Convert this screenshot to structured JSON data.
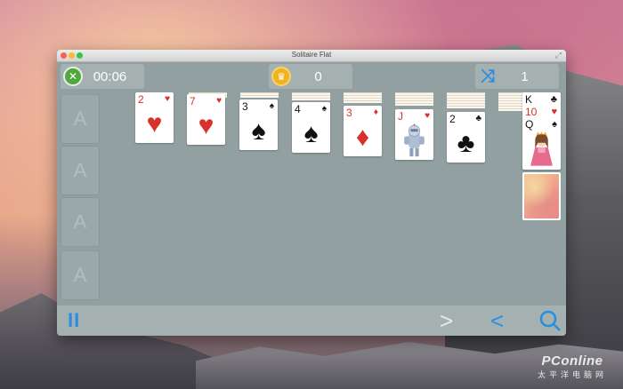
{
  "window": {
    "title": "Solitaire Flat"
  },
  "topbar": {
    "timer": "00:06",
    "score": "0",
    "moves": "1"
  },
  "foundations": [
    {
      "label": "A"
    },
    {
      "label": "A"
    },
    {
      "label": "A"
    },
    {
      "label": "A"
    }
  ],
  "tableau": [
    {
      "rank": "2",
      "suit": "♥",
      "color": "red"
    },
    {
      "rank": "7",
      "suit": "♥",
      "color": "red"
    },
    {
      "rank": "3",
      "suit": "♠",
      "color": "black"
    },
    {
      "rank": "4",
      "suit": "♠",
      "color": "black"
    },
    {
      "rank": "3",
      "suit": "♦",
      "color": "red"
    },
    {
      "rank": "J",
      "suit": "♥",
      "color": "red"
    },
    {
      "rank": "2",
      "suit": "♣",
      "color": "black"
    }
  ],
  "waste": [
    {
      "rank": "K",
      "suit": "♣",
      "color": "black"
    },
    {
      "rank": "10",
      "suit": "♥",
      "color": "red"
    },
    {
      "rank": "Q",
      "suit": "♠",
      "color": "black"
    }
  ],
  "bottombar": {
    "pause": "II",
    "next": ">",
    "prev": "<"
  },
  "watermark": {
    "main": "PConline",
    "sub": "太平洋电脑网"
  },
  "colors": {
    "accent": "#2a8ee0",
    "felt": "#93a0a1",
    "bar": "#a5b0b1"
  },
  "icons": {
    "timer": "timer-icon",
    "score": "crown-icon",
    "moves": "shuffle-icon",
    "hint": "hint-icon"
  }
}
